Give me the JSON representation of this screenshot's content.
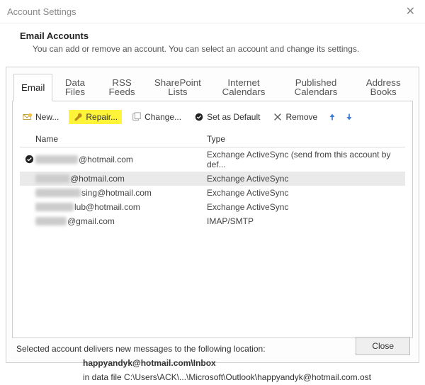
{
  "window": {
    "title": "Account Settings"
  },
  "header": {
    "title": "Email Accounts",
    "subtitle": "You can add or remove an account. You can select an account and change its settings."
  },
  "tabs": [
    {
      "label": "Email",
      "active": true
    },
    {
      "label": "Data Files"
    },
    {
      "label": "RSS Feeds"
    },
    {
      "label": "SharePoint Lists"
    },
    {
      "label": "Internet Calendars"
    },
    {
      "label": "Published Calendars"
    },
    {
      "label": "Address Books"
    }
  ],
  "toolbar": {
    "new": "New...",
    "repair": "Repair...",
    "change": "Change...",
    "set_default": "Set as Default",
    "remove": "Remove"
  },
  "columns": {
    "name": "Name",
    "type": "Type"
  },
  "accounts": [
    {
      "default": true,
      "name_suffix": "@hotmail.com",
      "type": "Exchange ActiveSync (send from this account by def..."
    },
    {
      "default": false,
      "name_suffix": "@hotmail.com",
      "type": "Exchange ActiveSync",
      "selected": true
    },
    {
      "default": false,
      "name_suffix": "sing@hotmail.com",
      "type": "Exchange ActiveSync"
    },
    {
      "default": false,
      "name_suffix": "lub@hotmail.com",
      "type": "Exchange ActiveSync"
    },
    {
      "default": false,
      "name_suffix": "@gmail.com",
      "type": "IMAP/SMTP"
    }
  ],
  "info": {
    "line1": "Selected account delivers new messages to the following location:",
    "location": "happyandyk@hotmail.com\\Inbox",
    "line2": "in data file C:\\Users\\ACK\\...\\Microsoft\\Outlook\\happyandyk@hotmail.com.ost"
  },
  "footer": {
    "close": "Close"
  }
}
